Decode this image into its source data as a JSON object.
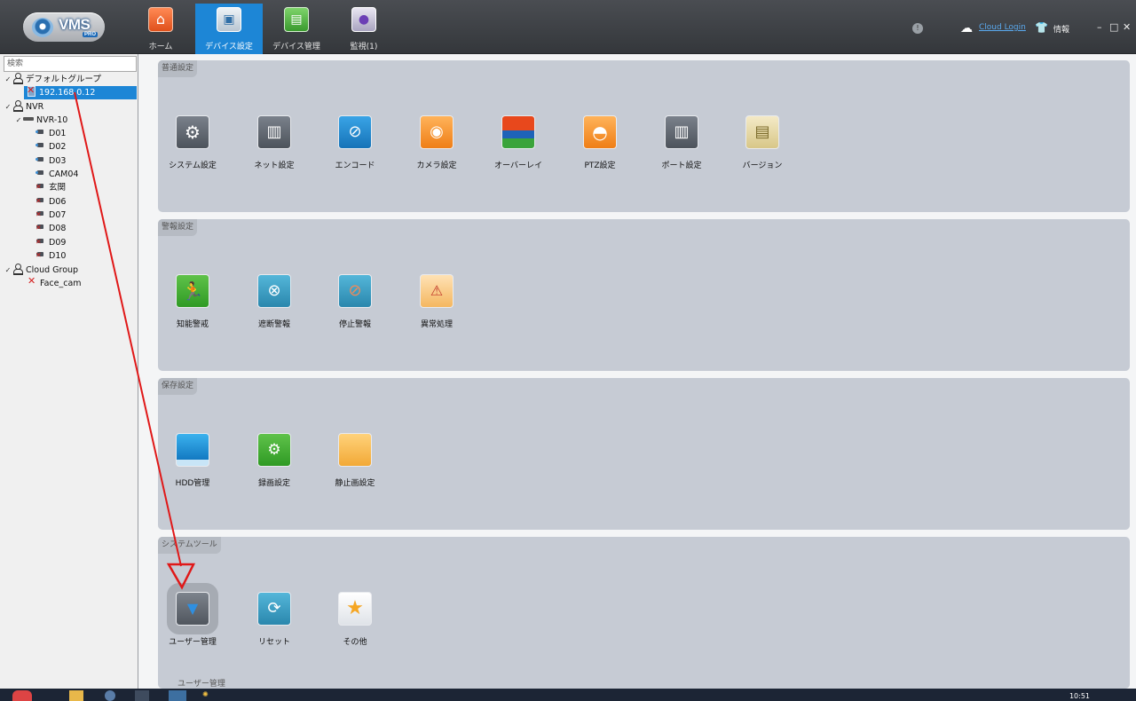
{
  "app": {
    "logo_text": "VMS",
    "logo_badge": "PRO"
  },
  "nav": {
    "tabs": [
      {
        "label": "ホーム",
        "icon": "home-icon"
      },
      {
        "label": "デバイス設定",
        "icon": "device-settings-icon",
        "active": true
      },
      {
        "label": "デバイス管理",
        "icon": "device-management-icon"
      },
      {
        "label": "監視(1)",
        "icon": "monitor-icon"
      }
    ]
  },
  "topright": {
    "cloud_login": "Cloud Login",
    "info": "情報",
    "minimize": "–",
    "maximize": "□",
    "close": "✕"
  },
  "sidebar": {
    "search_placeholder": "検索",
    "tree": {
      "default_group": "デフォルトグループ",
      "device_ip": "192.168.0.12",
      "nvr_group": "NVR",
      "nvr_device": "NVR-10",
      "channels": [
        "D01",
        "D02",
        "D03",
        "CAM04",
        "玄関",
        "D06",
        "D07",
        "D08",
        "D09",
        "D10"
      ],
      "cloud_group": "Cloud Group",
      "cloud_device": "Face_cam"
    }
  },
  "sections": {
    "general": {
      "title": "普通設定",
      "items": [
        "システム設定",
        "ネット設定",
        "エンコード",
        "カメラ設定",
        "オーバーレイ",
        "PTZ設定",
        "ポート設定",
        "バージョン"
      ]
    },
    "alarm": {
      "title": "警報設定",
      "items": [
        "知能警戒",
        "遮断警報",
        "停止警報",
        "異常処理"
      ]
    },
    "storage": {
      "title": "保存設定",
      "items": [
        "HDD管理",
        "録画設定",
        "静止画設定"
      ]
    },
    "tools": {
      "title": "システムツール",
      "items": [
        "ユーザー管理",
        "リセット",
        "その他"
      ]
    }
  },
  "status_hint": "ユーザー管理",
  "taskbar": {
    "clock": "10:51"
  },
  "colors": {
    "accent": "#1d86d6",
    "annotation_arrow": "#e01818"
  }
}
